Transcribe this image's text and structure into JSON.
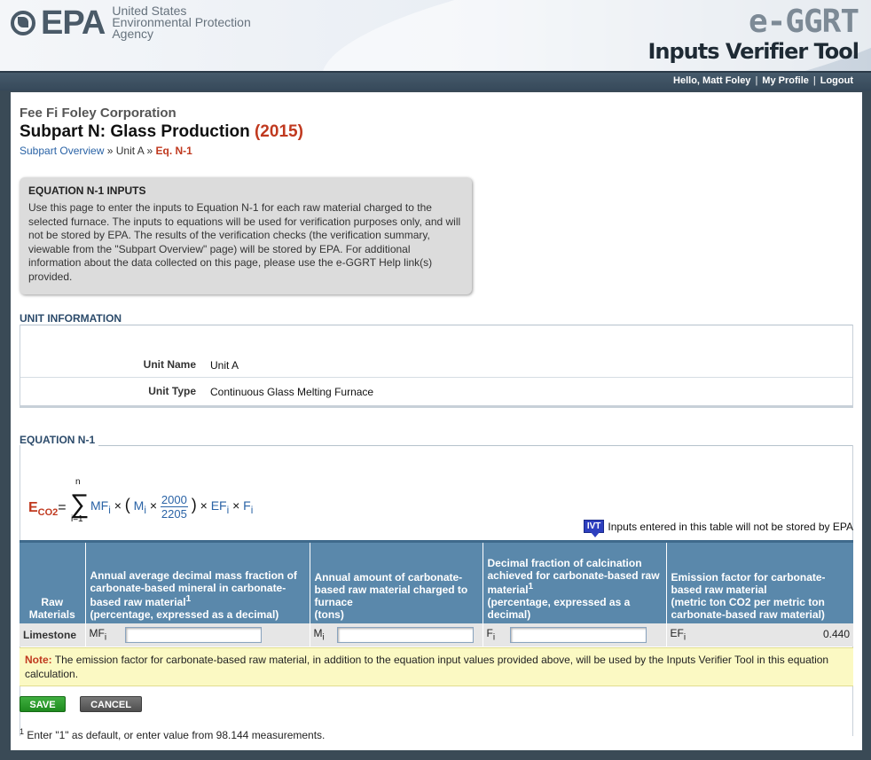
{
  "header": {
    "epa_word": "EPA",
    "agency_lines": [
      "United States",
      "Environmental Protection",
      "Agency"
    ],
    "app_name": "e-GGRT",
    "app_subtitle": "Inputs Verifier Tool"
  },
  "userbar": {
    "greeting": "Hello, Matt Foley",
    "my_profile": "My Profile",
    "logout": "Logout"
  },
  "page": {
    "facility": "Fee Fi Foley Corporation",
    "title_main": "Subpart N: Glass Production",
    "title_year": "(2015)",
    "breadcrumb": {
      "overview": "Subpart Overview",
      "sep1": "»",
      "unit": "Unit A",
      "sep2": "»",
      "current": "Eq. N-1"
    }
  },
  "infobox": {
    "title": "EQUATION N-1 INPUTS",
    "body": "Use this page to enter the inputs to Equation N-1 for each raw material charged to the selected furnace. The inputs to equations will be used for verification purposes only, and will not be stored by EPA. The results of the verification checks (the verification summary, viewable from the \"Subpart Overview\" page) will be stored by EPA. For additional information about the data collected on this page, please use the e-GGRT Help link(s) provided."
  },
  "unit_info": {
    "section_title": "UNIT INFORMATION",
    "name_label": "Unit Name",
    "name_value": "Unit A",
    "type_label": "Unit Type",
    "type_value": "Continuous Glass Melting Furnace"
  },
  "equation": {
    "section_title": "EQUATION N-1",
    "lhs": "E",
    "lhs_sub": "CO2",
    "eq_sign": "=",
    "sigma": "∑",
    "upper": "n",
    "lower": "i=1",
    "mf": "MF",
    "m": "M",
    "ef": "EF",
    "f": "F",
    "i_sub": "i",
    "times": "×",
    "open_paren": "(",
    "close_paren": ")",
    "frac_num": "2000",
    "frac_den": "2205"
  },
  "ivt": {
    "badge": "IVT",
    "note": "Inputs entered in this table will not be stored by EPA"
  },
  "table": {
    "headers": {
      "raw": "Raw Materials",
      "mf_main": "Annual average decimal mass fraction of carbonate-based mineral in carbonate-based raw material",
      "mf_fn": "1",
      "mf_sub": "(percentage, expressed as a decimal)",
      "m_main": "Annual amount of carbonate-based raw material charged to furnace",
      "m_sub": "(tons)",
      "f_main": "Decimal fraction of calcination achieved for carbonate-based raw material",
      "f_fn": "1",
      "f_sub": "(percentage, expressed as a decimal)",
      "ef_main": "Emission factor for carbonate-based raw material",
      "ef_sub": "(metric ton CO2 per metric ton carbonate-based raw material)"
    },
    "row": {
      "material": "Limestone",
      "mf_sym": "MF",
      "m_sym": "M",
      "f_sym": "F",
      "ef_sym": "EF",
      "i_sub": "i",
      "mf_value": "",
      "m_value": "",
      "f_value": "",
      "ef_value": "0.440"
    }
  },
  "note": {
    "label": "Note:",
    "text": "The emission factor for carbonate-based raw material, in addition to the equation input values provided above, will be used by the Inputs Verifier Tool in this equation calculation."
  },
  "buttons": {
    "save": "SAVE",
    "cancel": "CANCEL"
  },
  "footnote": {
    "mark": "1",
    "text": "Enter \"1\" as default, or enter value from 98.144 measurements."
  },
  "colors": {
    "accent_red": "#c0391f",
    "link_blue": "#2a63a6",
    "table_header": "#5a88ab",
    "save_green": "#2a9a2a"
  }
}
